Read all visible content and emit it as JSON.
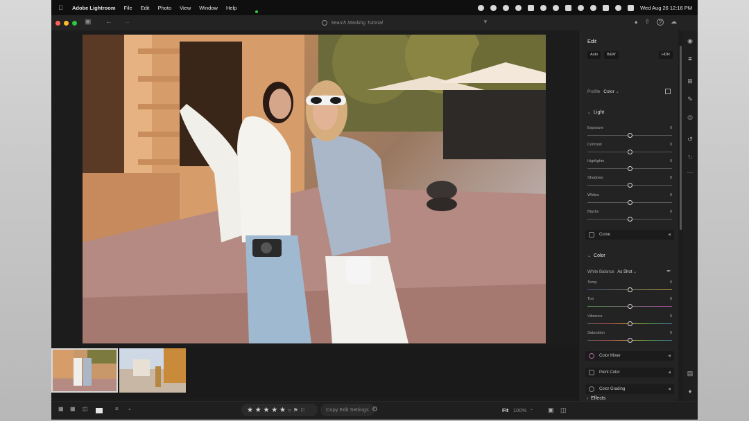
{
  "menubar": {
    "app_name": "Adobe Lightroom",
    "menus": [
      "File",
      "Edit",
      "Photo",
      "View",
      "Window",
      "Help"
    ],
    "datetime": "Wed Aug 26  12:16 PM"
  },
  "titlebar": {
    "search_placeholder": "Search Masking Tutorial"
  },
  "edit_panel": {
    "title": "Edit",
    "buttons": {
      "auto": "Auto",
      "bw": "B&W",
      "hdr": "HDR"
    },
    "profile_label": "Profile",
    "profile_value": "Color",
    "light": {
      "title": "Light",
      "sliders": [
        {
          "label": "Exposure",
          "value": "0"
        },
        {
          "label": "Contrast",
          "value": "0"
        },
        {
          "label": "Highlights",
          "value": "0"
        },
        {
          "label": "Shadows",
          "value": "0"
        },
        {
          "label": "Whites",
          "value": "0"
        },
        {
          "label": "Blacks",
          "value": "0"
        }
      ],
      "curve": "Curve"
    },
    "color": {
      "title": "Color",
      "wb_label": "White Balance",
      "wb_value": "As Shot",
      "sliders": [
        {
          "label": "Temp",
          "value": "0"
        },
        {
          "label": "Tint",
          "value": "0"
        },
        {
          "label": "Vibrance",
          "value": "0"
        },
        {
          "label": "Saturation",
          "value": "0"
        }
      ],
      "tools": [
        "Color Mixer",
        "Point Color",
        "Color Grading"
      ]
    },
    "effects": {
      "title": "Effects"
    }
  },
  "bottombar": {
    "copy_edit": "Copy Edit Settings",
    "fit": "Fit",
    "zoom": "100%",
    "stars": "★ ★ ★ ★ ★"
  },
  "colors": {
    "panel_bg": "#232323",
    "app_bg": "#1c1c1c",
    "accent_text": "#e6e6e6"
  }
}
